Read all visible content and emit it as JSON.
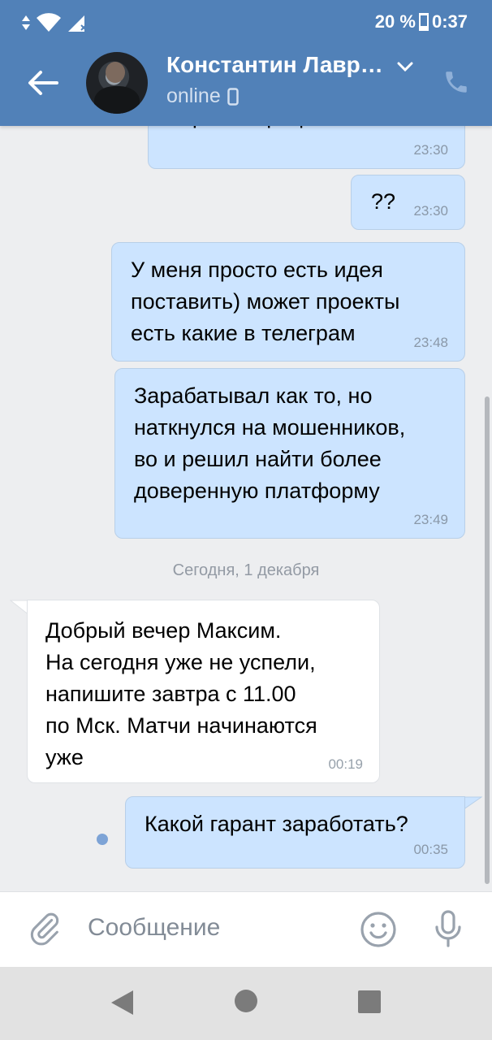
{
  "status_bar": {
    "battery": "20 %",
    "time": "0:37"
  },
  "header": {
    "contact_name": "Константин Лавр…",
    "presence": "online"
  },
  "messages": [
    {
      "text": "норм коофецієнтам",
      "time": "23:30"
    },
    {
      "text": "??",
      "time": "23:30"
    },
    {
      "text": "У меня просто есть идея\nпоставить) может проекты\nесть какие в телеграм",
      "time": "23:48"
    },
    {
      "text": "Зарабатывал как то, но\nнаткнулся на мошенников,\nво и решил найти более\nдоверенную платформу",
      "time": "23:49"
    },
    {
      "text": "Добрый вечер Максим.\nНа сегодня уже не успели,\nнапишите завтра с 11.00\nпо Мск. Матчи начинаются\nуже",
      "time": "00:19"
    },
    {
      "text": "Какой гарант заработать?",
      "time": "00:35"
    }
  ],
  "date_separator": "Сегодня, 1 декабря",
  "composer": {
    "placeholder": "Сообщение"
  },
  "colors": {
    "header": "#5181b8",
    "outgoing_bubble": "#cce4ff",
    "incoming_bubble": "#ffffff",
    "background": "#edeef0"
  }
}
